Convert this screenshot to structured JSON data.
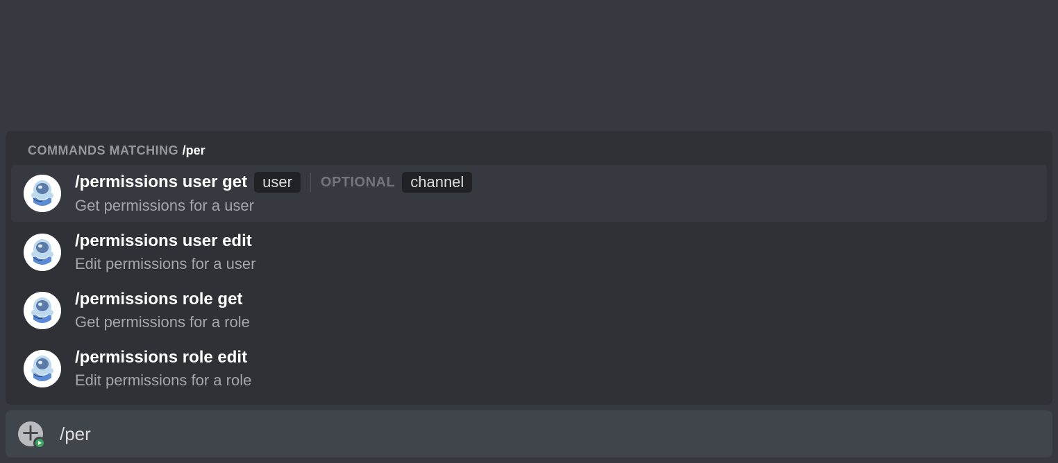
{
  "panel": {
    "header_label": "COMMANDS MATCHING ",
    "header_query": "/per",
    "optional_label": "OPTIONAL"
  },
  "commands": [
    {
      "name": "/permissions user get",
      "description": "Get permissions for a user",
      "params": [
        "user"
      ],
      "optional_params": [
        "channel"
      ],
      "selected": true
    },
    {
      "name": "/permissions user edit",
      "description": "Edit permissions for a user",
      "params": [],
      "optional_params": [],
      "selected": false
    },
    {
      "name": "/permissions role get",
      "description": "Get permissions for a role",
      "params": [],
      "optional_params": [],
      "selected": false
    },
    {
      "name": "/permissions role edit",
      "description": "Edit permissions for a role",
      "params": [],
      "optional_params": [],
      "selected": false
    }
  ],
  "input": {
    "value": "/per"
  }
}
